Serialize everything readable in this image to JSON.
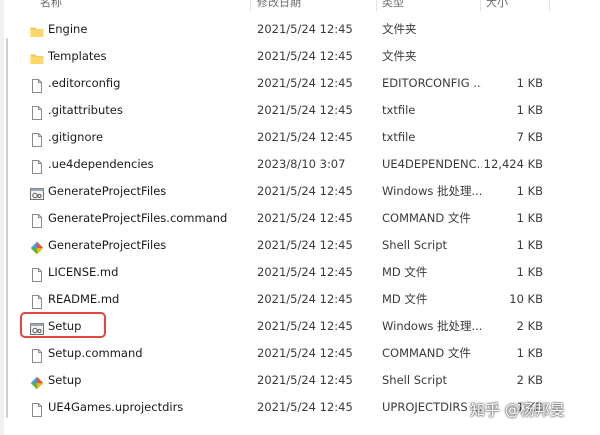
{
  "header": {
    "name": "名称",
    "date": "修改日期",
    "type": "类型",
    "size": "大小"
  },
  "files": [
    {
      "name": "Engine",
      "date": "2021/5/24 12:45",
      "type": "文件夹",
      "size": "",
      "icon": "folder-icon"
    },
    {
      "name": "Templates",
      "date": "2021/5/24 12:45",
      "type": "文件夹",
      "size": "",
      "icon": "folder-icon"
    },
    {
      "name": ".editorconfig",
      "date": "2021/5/24 12:45",
      "type": "EDITORCONFIG ...",
      "size": "1 KB",
      "icon": "file-icon"
    },
    {
      "name": ".gitattributes",
      "date": "2021/5/24 12:45",
      "type": "txtfile",
      "size": "1 KB",
      "icon": "file-icon"
    },
    {
      "name": ".gitignore",
      "date": "2021/5/24 12:45",
      "type": "txtfile",
      "size": "7 KB",
      "icon": "file-icon"
    },
    {
      "name": ".ue4dependencies",
      "date": "2023/8/10 3:07",
      "type": "UE4DEPENDENC...",
      "size": "12,424 KB",
      "icon": "file-icon"
    },
    {
      "name": "GenerateProjectFiles",
      "date": "2021/5/24 12:45",
      "type": "Windows 批处理...",
      "size": "1 KB",
      "icon": "batch-file-icon"
    },
    {
      "name": "GenerateProjectFiles.command",
      "date": "2021/5/24 12:45",
      "type": "COMMAND 文件",
      "size": "1 KB",
      "icon": "file-icon"
    },
    {
      "name": "GenerateProjectFiles",
      "date": "2021/5/24 12:45",
      "type": "Shell Script",
      "size": "1 KB",
      "icon": "shell-script-icon"
    },
    {
      "name": "LICENSE.md",
      "date": "2021/5/24 12:45",
      "type": "MD 文件",
      "size": "1 KB",
      "icon": "file-icon"
    },
    {
      "name": "README.md",
      "date": "2021/5/24 12:45",
      "type": "MD 文件",
      "size": "10 KB",
      "icon": "file-icon"
    },
    {
      "name": "Setup",
      "date": "2021/5/24 12:45",
      "type": "Windows 批处理...",
      "size": "2 KB",
      "icon": "batch-file-icon"
    },
    {
      "name": "Setup.command",
      "date": "2021/5/24 12:45",
      "type": "COMMAND 文件",
      "size": "1 KB",
      "icon": "file-icon"
    },
    {
      "name": "Setup",
      "date": "2021/5/24 12:45",
      "type": "Shell Script",
      "size": "2 KB",
      "icon": "shell-script-icon"
    },
    {
      "name": "UE4Games.uprojectdirs",
      "date": "2021/5/24 12:45",
      "type": "UPROJECTDIRS ...",
      "size": "1 KB",
      "icon": "file-icon"
    }
  ],
  "highlight_row": 11,
  "highlight_color": "#e2463d",
  "watermark": "知乎 @杨邦旻"
}
